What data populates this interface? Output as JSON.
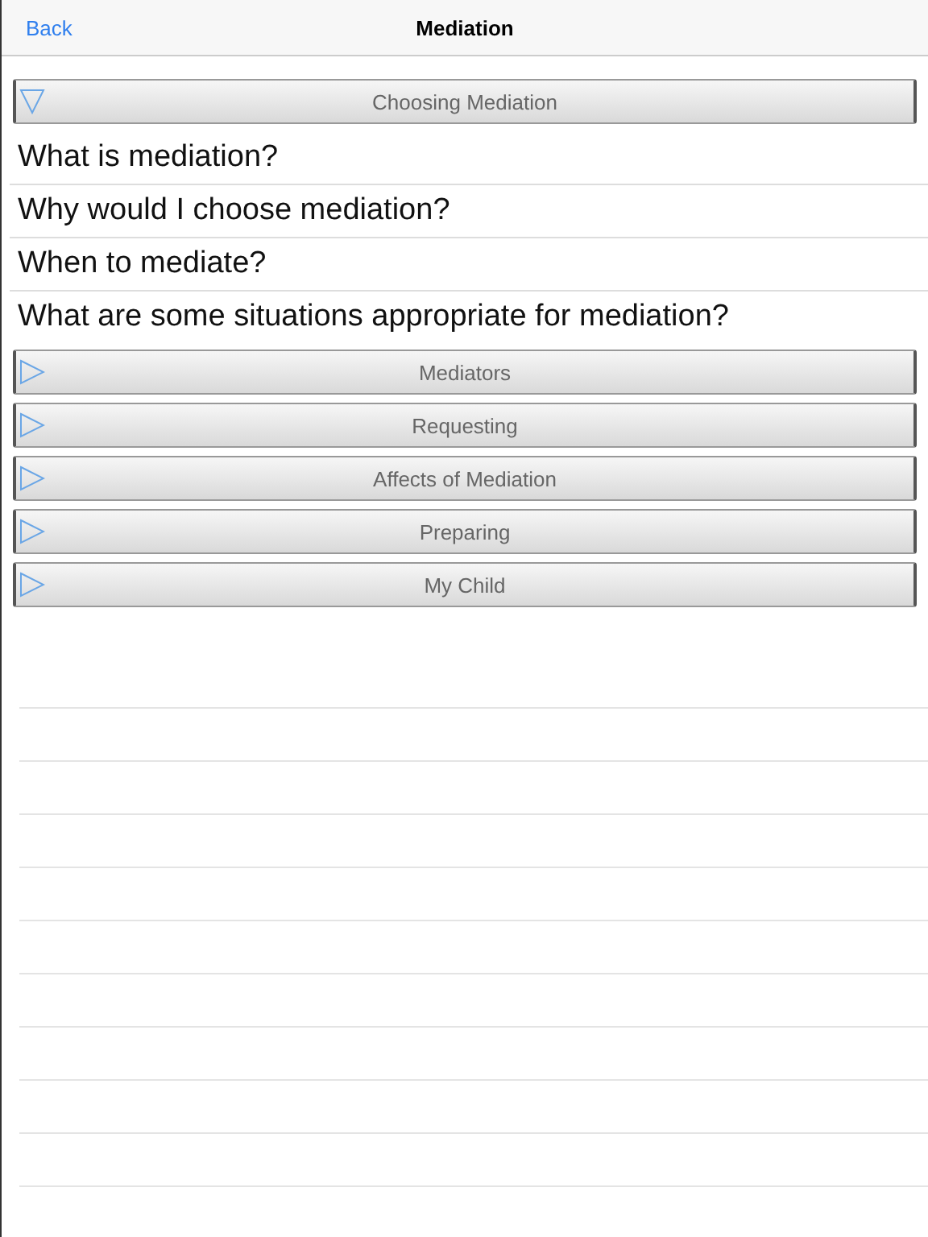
{
  "nav_bar": {
    "back": "Back",
    "title": "Mediation"
  },
  "sections": [
    {
      "title": "Choosing Mediation",
      "expanded": true,
      "items": [
        "What is mediation?",
        "Why would I choose mediation?",
        "When to mediate?",
        "What are some situations appropriate for mediation?"
      ]
    },
    {
      "title": "Mediators",
      "expanded": false
    },
    {
      "title": "Requesting",
      "expanded": false
    },
    {
      "title": "Affects of Mediation",
      "expanded": false
    },
    {
      "title": "Preparing",
      "expanded": false
    },
    {
      "title": "My Child",
      "expanded": false
    }
  ]
}
